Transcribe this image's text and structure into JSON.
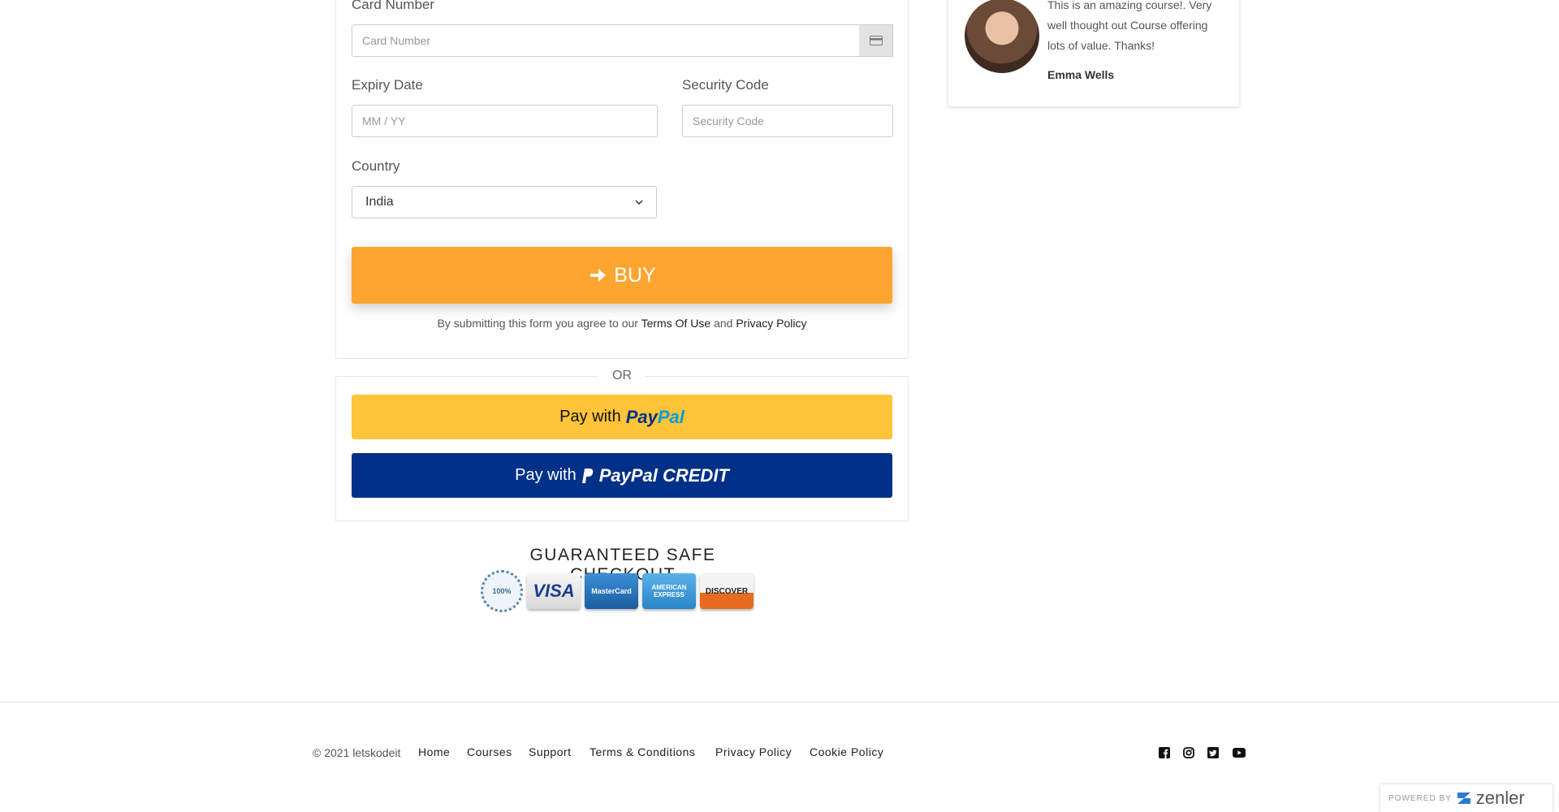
{
  "card_form": {
    "card_number_label": "Card Number",
    "card_number_placeholder": "Card Number",
    "expiry_label": "Expiry Date",
    "expiry_placeholder": "MM / YY",
    "security_label": "Security Code",
    "security_placeholder": "Security Code",
    "country_label": "Country",
    "country_value": "India",
    "buy_label": "BUY",
    "terms_prefix": "By submitting this form you agree to our",
    "terms_link": "Terms Of Use",
    "terms_and": "and",
    "privacy_link": "Privacy Policy"
  },
  "or_label": "OR",
  "paypal": {
    "pay_with": "Pay with",
    "paypal_word": "PayPal",
    "credit_pay_with": "Pay with",
    "credit_word": "PayPal CREDIT"
  },
  "checkout": {
    "title": "GUARANTEED SAFE CHECKOUT",
    "seal_text": "100%",
    "visa": "VISA",
    "mastercard": "MasterCard",
    "amex": "AMERICAN EXPRESS",
    "discover": "DISCOVER"
  },
  "testimonial": {
    "text": "This is an amazing course!. Very well thought out Course offering lots of value. Thanks!",
    "name": "Emma Wells"
  },
  "footer": {
    "copyright": "© 2021 letskodeit",
    "links": [
      "Home",
      "Courses",
      "Support",
      "Terms & Conditions",
      "Privacy Policy",
      "Cookie Policy"
    ]
  },
  "powered": {
    "powered_by": "POWERED BY",
    "brand": "zenler"
  },
  "colors": {
    "buy": "#fea531",
    "paypal_gold": "#ffc439",
    "paypal_blue": "#003087"
  }
}
